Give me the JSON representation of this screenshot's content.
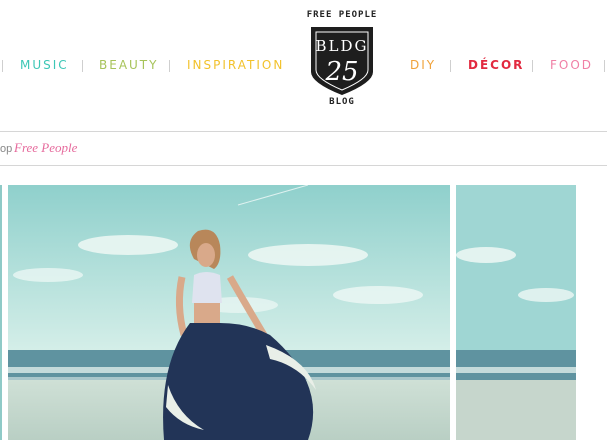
{
  "nav": {
    "items": [
      {
        "label": "MUSIC",
        "color": "#3dc7b6"
      },
      {
        "label": "BEAUTY",
        "color": "#a7c35a"
      },
      {
        "label": "INSPIRATION",
        "color": "#f2c22c"
      },
      {
        "label": "DIY",
        "color": "#f0a23a"
      },
      {
        "label": "DÉCOR",
        "color": "#e2293f"
      },
      {
        "label": "FOOD",
        "color": "#f07fa5"
      }
    ]
  },
  "logo": {
    "top_text": "FREE PEOPLE",
    "line1": "BLDG",
    "line2": "25",
    "bottom_text": "BLOG"
  },
  "shop": {
    "prefix": "op",
    "brand": "Free People"
  },
  "photos": {
    "main_alt": "woman in flowing skirt on beach",
    "side_alt": "beach"
  },
  "colors": {
    "sky": "#9fd6d3",
    "sea": "#5f93a0",
    "sand": "#c6d6cc",
    "divider": "#d6d6d6"
  }
}
